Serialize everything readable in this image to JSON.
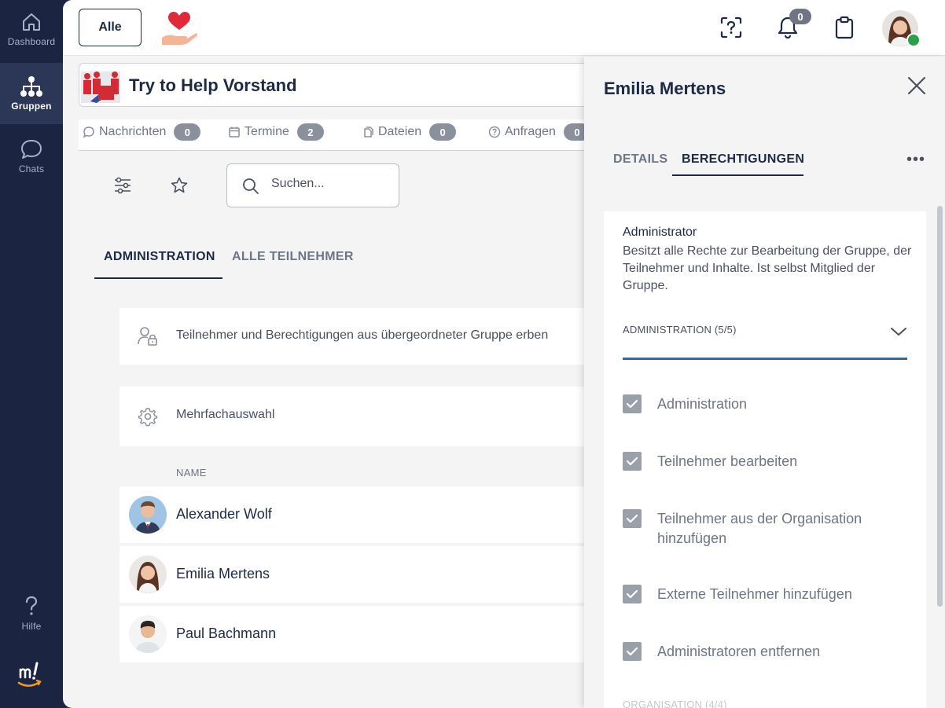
{
  "nav": {
    "dashboard_label": "Dashboard",
    "groups_label": "Gruppen",
    "chats_label": "Chats",
    "help_label": "Hilfe"
  },
  "topbar": {
    "all_button": "Alle",
    "notifications_count": "0"
  },
  "group": {
    "title": "Try to Help Vorstand",
    "tabs": [
      {
        "label": "Nachrichten",
        "count": "0",
        "icon": "chat-bubble-icon"
      },
      {
        "label": "Termine",
        "count": "2",
        "icon": "calendar-icon"
      },
      {
        "label": "Dateien",
        "count": "0",
        "icon": "file-icon"
      },
      {
        "label": "Anfragen",
        "count": "0",
        "icon": "question-icon"
      }
    ]
  },
  "search": {
    "placeholder": "Suchen..."
  },
  "subtabs": {
    "active": "ADMINISTRATION",
    "inactive": "ALLE TEILNEHMER"
  },
  "inherit_text": "Teilnehmer und Berechtigungen aus übergeordneter Gruppe erben",
  "multi_select_text": "Mehrfachauswahl",
  "members_header": "NAME",
  "members": [
    {
      "name": "Alexander Wolf"
    },
    {
      "name": "Emilia Mertens"
    },
    {
      "name": "Paul Bachmann"
    }
  ],
  "panel": {
    "title": "Emilia Mertens",
    "tab_details": "DETAILS",
    "tab_permissions": "BERECHTIGUNGEN",
    "role_name": "Administrator",
    "role_description": "Besitzt alle Rechte zur Bearbeitung der Gruppe, der Teilnehmer und Inhalte. Ist selbst Mitglied der Gruppe.",
    "section_title": "ADMINISTRATION (5/5)",
    "permissions": [
      {
        "label": "Administration",
        "checked": true
      },
      {
        "label": "Teilnehmer bearbeiten",
        "checked": true
      },
      {
        "label": "Teilnehmer aus der Organisation hinzufügen",
        "checked": true
      },
      {
        "label": "Externe Teilnehmer hinzufügen",
        "checked": true
      },
      {
        "label": "Administratoren entfernen",
        "checked": true
      }
    ],
    "next_section_title": "ORGANISATION (4/4)"
  },
  "colors": {
    "nav_bg": "#1b2440",
    "accent_blue": "#1f6fb2",
    "online_green": "#2aa148",
    "heart_red": "#e02a3a"
  }
}
